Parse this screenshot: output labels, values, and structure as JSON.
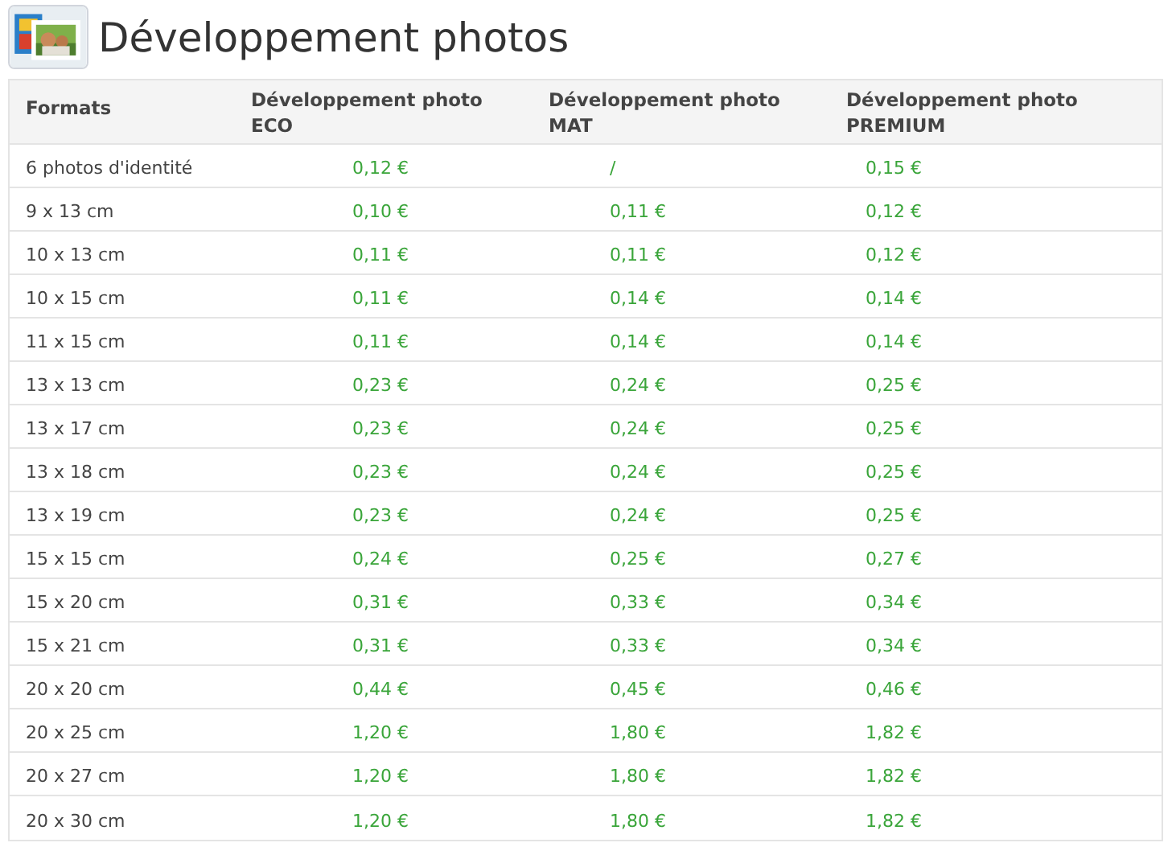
{
  "title": "Développement photos",
  "table": {
    "columns": [
      "Formats",
      "Développement photo ECO",
      "Développement photo MAT",
      "Développement photo PREMIUM"
    ],
    "rows": [
      [
        "6 photos d'identité",
        "0,12 €",
        "/",
        "0,15 €"
      ],
      [
        "9 x 13 cm",
        "0,10 €",
        "0,11 €",
        "0,12 €"
      ],
      [
        "10 x 13 cm",
        "0,11 €",
        "0,11 €",
        "0,12 €"
      ],
      [
        "10 x 15 cm",
        "0,11 €",
        "0,14 €",
        "0,14 €"
      ],
      [
        "11 x 15 cm",
        "0,11 €",
        "0,14 €",
        "0,14 €"
      ],
      [
        "13 x 13 cm",
        "0,23 €",
        "0,24 €",
        "0,25 €"
      ],
      [
        "13 x 17 cm",
        "0,23 €",
        "0,24 €",
        "0,25 €"
      ],
      [
        "13 x 18 cm",
        "0,23 €",
        "0,24 €",
        "0,25 €"
      ],
      [
        "13 x 19 cm",
        "0,23 €",
        "0,24 €",
        "0,25 €"
      ],
      [
        "15 x 15 cm",
        "0,24 €",
        "0,25 €",
        "0,27 €"
      ],
      [
        "15 x 20 cm",
        "0,31 €",
        "0,33 €",
        "0,34 €"
      ],
      [
        "15 x 21 cm",
        "0,31 €",
        "0,33 €",
        "0,34 €"
      ],
      [
        "20 x 20 cm",
        "0,44 €",
        "0,45 €",
        "0,46 €"
      ],
      [
        "20 x 25 cm",
        "1,20 €",
        "1,80 €",
        "1,82 €"
      ],
      [
        "20 x 27 cm",
        "1,20 €",
        "1,80 €",
        "1,82 €"
      ],
      [
        "20 x 30 cm",
        "1,20 €",
        "1,80 €",
        "1,82 €"
      ]
    ]
  }
}
